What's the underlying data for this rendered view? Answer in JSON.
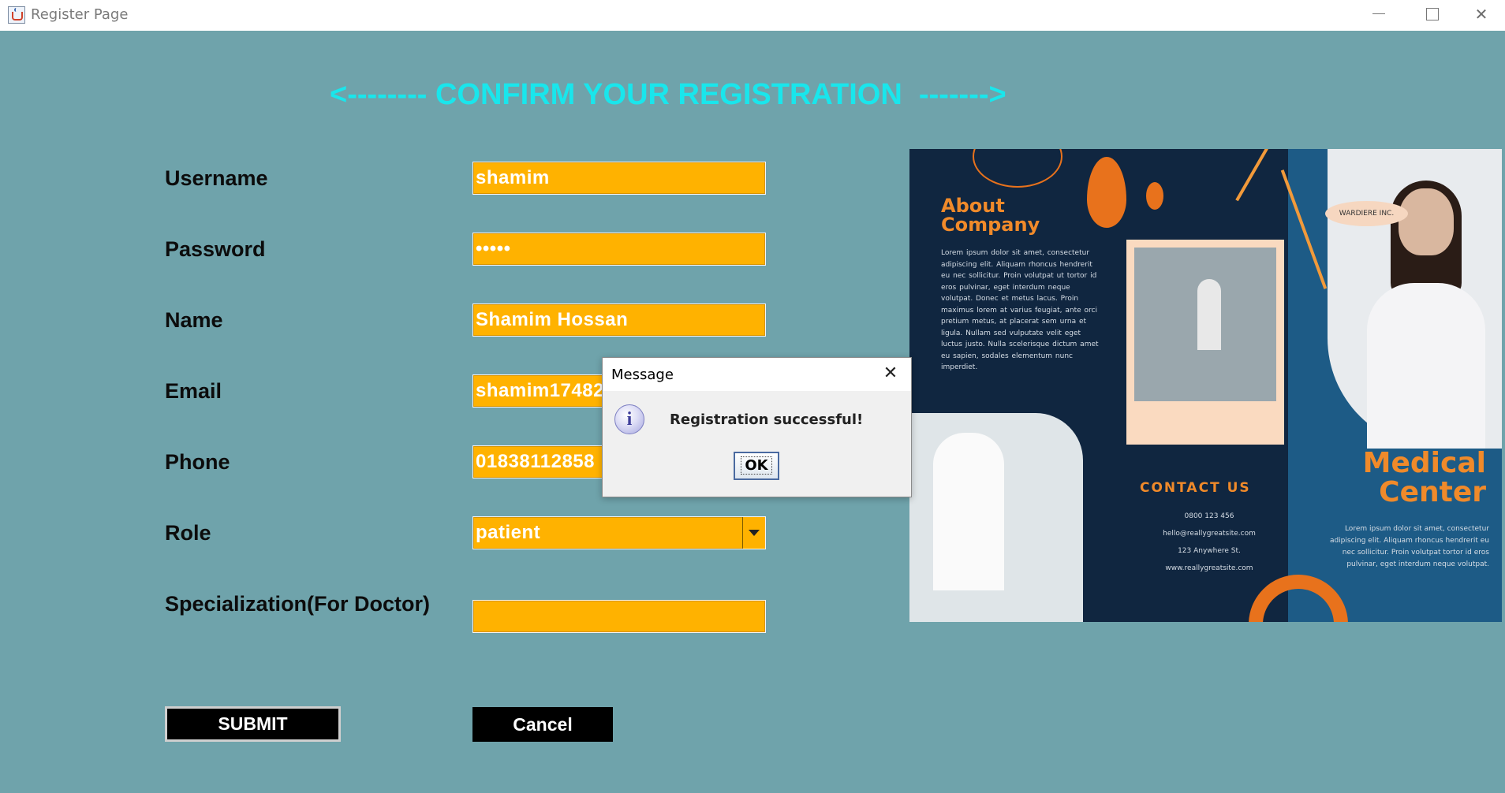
{
  "window": {
    "title": "Register Page",
    "minimize_glyph": "",
    "close_glyph": "✕"
  },
  "form": {
    "heading": "<-------- CONFIRM YOUR REGISTRATION  ------->",
    "fields": [
      {
        "label": "Username",
        "value": "shamim"
      },
      {
        "label": "Password",
        "value": "•••••"
      },
      {
        "label": "Name",
        "value": "Shamim Hossan"
      },
      {
        "label": "Email",
        "value": "shamim174828"
      },
      {
        "label": "Phone",
        "value": "01838112858"
      },
      {
        "label": "Role",
        "value": "patient"
      },
      {
        "label": "Specialization(For Doctor)",
        "value": ""
      }
    ],
    "submit_label": "SUBMIT",
    "cancel_label": "Cancel"
  },
  "brochure": {
    "about_title": "About\nCompany",
    "about_body": "Lorem ipsum dolor sit amet, consectetur adipiscing elit. Aliquam rhoncus hendrerit eu nec sollicitur. Proin volutpat ut tortor id eros pulvinar, eget interdum neque volutpat. Donec et metus lacus. Proin maximus lorem at varius feugiat, ante orci pretium metus, at placerat sem urna et ligula. Nullam sed vulputate velit eget luctus justo. Nulla scelerisque dictum amet eu sapien, sodales elementum nunc imperdiet.",
    "contact_title": "CONTACT US",
    "contact_lines": [
      "0800 123 456",
      "hello@reallygreatsite.com",
      "123 Anywhere St.",
      "www.reallygreatsite.com"
    ],
    "tag": "WARDIERE INC.",
    "medical_title": "Medical\nCenter",
    "medical_body": "Lorem ipsum dolor sit amet, consectetur adipiscing elit. Aliquam rhoncus hendrerit eu nec sollicitur. Proin volutpat tortor id eros pulvinar, eget interdum neque volutpat."
  },
  "dialog": {
    "title": "Message",
    "message": "Registration successful!",
    "ok_label": "OK",
    "icon": "info-icon",
    "icon_glyph": "i",
    "close_glyph": "✕"
  },
  "colors": {
    "background": "#6fa3ab",
    "heading": "#19e6ec",
    "field": "#ffb200",
    "button": "#000000",
    "accent": "#f08a2a"
  }
}
